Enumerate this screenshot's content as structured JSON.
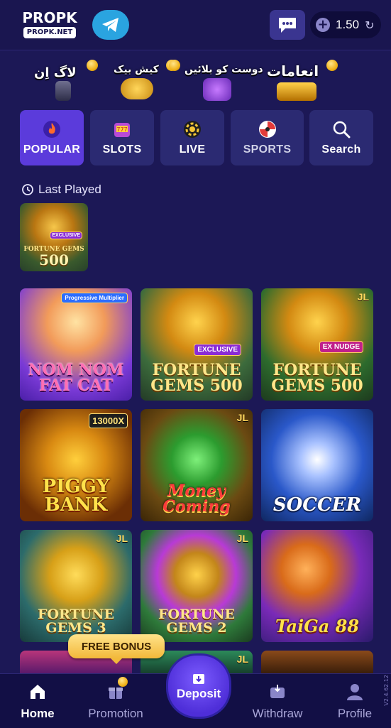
{
  "header": {
    "logo_top": "PROPK",
    "logo_bottom": "PROPK.NET",
    "balance": "1.50"
  },
  "features": [
    {
      "label": "لاگ اِن"
    },
    {
      "label": "کیش بیک"
    },
    {
      "label": "دوست کو بلائیں"
    },
    {
      "label": "انعامات"
    }
  ],
  "tabs": [
    {
      "label": "POPULAR",
      "icon": "fire-icon"
    },
    {
      "label": "SLOTS",
      "icon": "slot-machine-icon"
    },
    {
      "label": "LIVE",
      "icon": "casino-chip-icon"
    },
    {
      "label": "SPORTS",
      "icon": "soccer-ball-icon"
    },
    {
      "label": "Search",
      "icon": "search-icon"
    }
  ],
  "last_played": {
    "title": "Last Played",
    "game": {
      "line1": "FORTUNE GEMS",
      "line2": "500",
      "badge": "EXCLUSIVE"
    }
  },
  "games": [
    {
      "name": "NOM NOM FAT CAT",
      "badge": "Progressive Multiplier",
      "jl": ""
    },
    {
      "name": "FORTUNE GEMS 500",
      "badge": "EXCLUSIVE",
      "jl": ""
    },
    {
      "name": "FORTUNE GEMS 500",
      "badge": "EX NUDGE",
      "jl": "JL"
    },
    {
      "name": "PIGGY BANK",
      "badge": "13000X",
      "jl": ""
    },
    {
      "name": "Money Coming",
      "badge": "",
      "jl": "JL"
    },
    {
      "name": "SOCCER",
      "badge": "",
      "jl": ""
    },
    {
      "name": "FORTUNE GEMS 3",
      "badge": "",
      "jl": "JL"
    },
    {
      "name": "FORTUNE GEMS 2",
      "badge": "",
      "jl": "JL"
    },
    {
      "name": "TaiGa 88",
      "badge": "",
      "jl": ""
    }
  ],
  "free_bonus": "FREE BONUS",
  "bottom_nav": {
    "home": "Home",
    "promotion": "Promotion",
    "deposit": "Deposit",
    "withdraw": "Withdraw",
    "profile": "Profile"
  },
  "side_text": "V2.4.62.12"
}
